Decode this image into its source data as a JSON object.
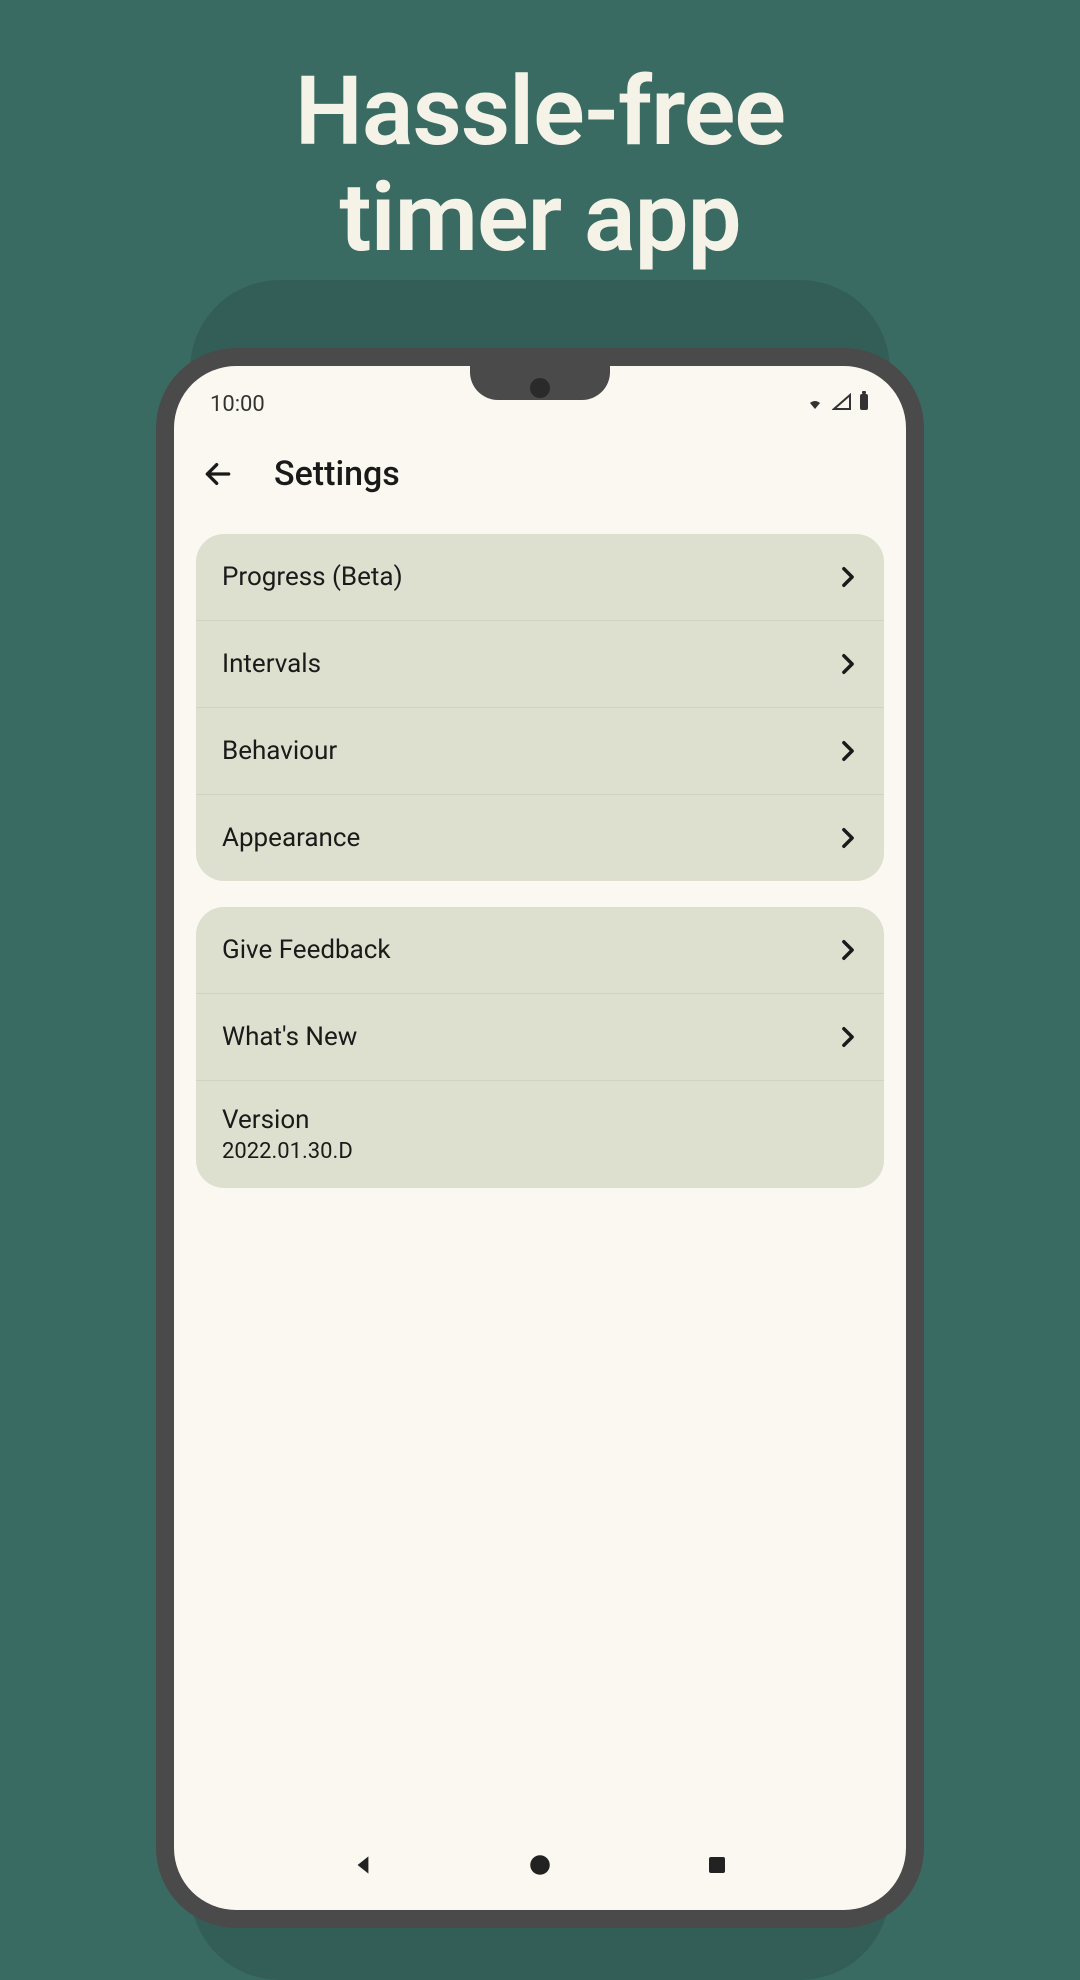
{
  "headline_line1": "Hassle-free",
  "headline_line2": "timer app",
  "status": {
    "time": "10:00"
  },
  "appbar": {
    "title": "Settings"
  },
  "group1": {
    "items": [
      {
        "label": "Progress (Beta)"
      },
      {
        "label": "Intervals"
      },
      {
        "label": "Behaviour"
      },
      {
        "label": "Appearance"
      }
    ]
  },
  "group2": {
    "items": [
      {
        "label": "Give Feedback"
      },
      {
        "label": "What's New"
      }
    ],
    "version_label": "Version",
    "version_value": "2022.01.30.D"
  }
}
